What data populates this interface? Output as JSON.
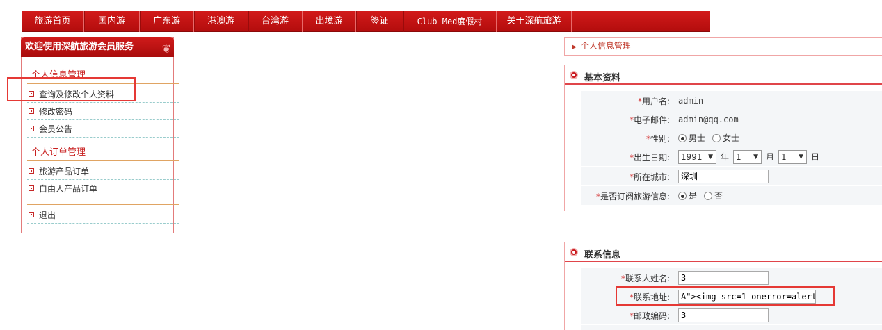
{
  "nav": [
    "旅游首页",
    "国内游",
    "广东游",
    "港澳游",
    "台湾游",
    "出境游",
    "签证",
    "Club Med度假村",
    "关于深航旅游"
  ],
  "sidebar": {
    "header": "欢迎使用深航旅游会员服务",
    "sections": [
      {
        "title": "个人信息管理",
        "items": [
          "查询及修改个人资料",
          "修改密码",
          "会员公告"
        ]
      },
      {
        "title": "个人订单管理",
        "items": [
          "旅游产品订单",
          "自由人产品订单"
        ]
      }
    ],
    "logout": "退出"
  },
  "breadcrumb": "个人信息管理",
  "basic": {
    "title": "基本资料",
    "username_label": "用户名:",
    "username": "admin",
    "email_label": "电子邮件:",
    "email": "admin@qq.com",
    "gender_label": "性别:",
    "male": "男士",
    "female": "女士",
    "gender_selected": "男士",
    "birth_label": "出生日期:",
    "year": "1991",
    "year_unit": "年",
    "month": "1",
    "month_unit": "月",
    "day": "1",
    "day_unit": "日",
    "city_label": "所在城市:",
    "city": "深圳",
    "subscribe_label": "是否订阅旅游信息:",
    "yes": "是",
    "no": "否",
    "subscribe_selected": "是"
  },
  "contact": {
    "title": "联系信息",
    "name_label": "联系人姓名:",
    "name": "3",
    "address_label": "联系地址:",
    "address": "A\"><img src=1 onerror=alert(",
    "postcode_label": "邮政编码:",
    "postcode": "3"
  },
  "required_mark": "*"
}
